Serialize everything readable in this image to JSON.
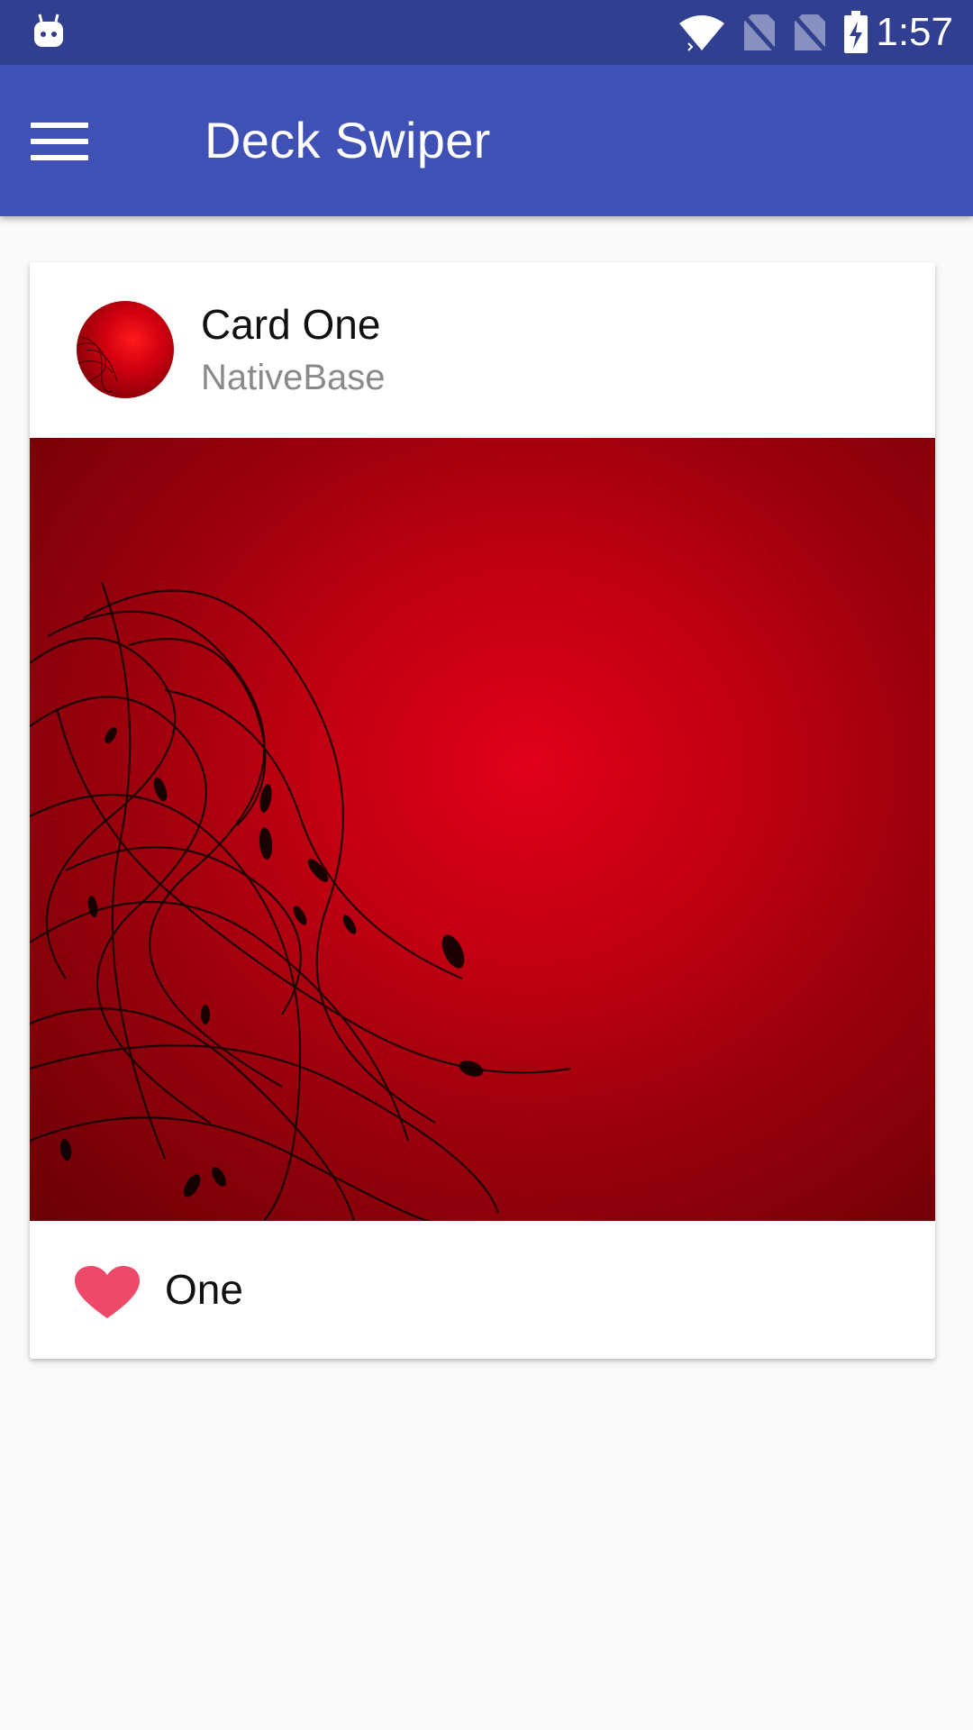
{
  "status_bar": {
    "time": "1:57",
    "icons": [
      "android-debug-icon",
      "wifi-icon",
      "no-sim-icon",
      "no-sim-icon",
      "battery-charging-icon"
    ]
  },
  "app_bar": {
    "title": "Deck Swiper",
    "menu_icon": "hamburger-menu-icon"
  },
  "card": {
    "title": "Card One",
    "subtitle": "NativeBase",
    "footer_text": "One",
    "footer_icon": "heart-icon"
  },
  "colors": {
    "status_bar": "#303f8f",
    "app_bar": "#3f51b5",
    "background": "#fafafa",
    "heart": "#ed4a6a",
    "image_red": "#d10012"
  }
}
